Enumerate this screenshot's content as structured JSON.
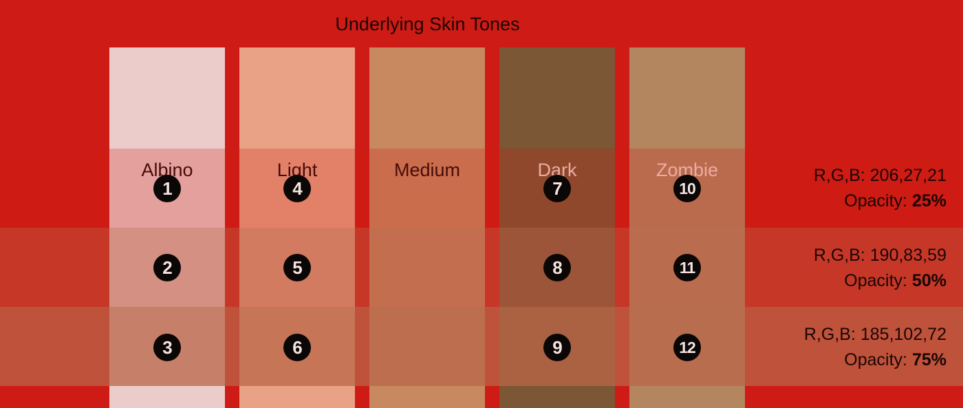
{
  "title": "Underlying Skin Tones",
  "tones": [
    {
      "label": "Albino",
      "color": "#ebccca",
      "label_color": "#1a0604"
    },
    {
      "label": "Light",
      "color": "#e9a285",
      "label_color": "#1a0604"
    },
    {
      "label": "Medium",
      "color": "#c88860",
      "label_color": "#1a0604"
    },
    {
      "label": "Dark",
      "color": "#7b5735",
      "label_color": "#f2ddd6"
    },
    {
      "label": "Zombie",
      "color": "#b48660",
      "label_color": "#f2ddd6"
    }
  ],
  "overlays": [
    {
      "rgb_label": "R,G,B: 206,27,21",
      "opacity_label": "Opacity: ",
      "opacity_value": "25%",
      "color": "#ce1b15",
      "opacity": 0.25
    },
    {
      "rgb_label": "R,G,B: 190,83,59",
      "opacity_label": "Opacity: ",
      "opacity_value": "50%",
      "color": "#be533b",
      "opacity": 0.5
    },
    {
      "rgb_label": "R,G,B: 185,102,72",
      "opacity_label": "Opacity: ",
      "opacity_value": "75%",
      "color": "#b96648",
      "opacity": 0.75
    }
  ],
  "markers": [
    "1",
    "2",
    "3",
    "4",
    "5",
    "6",
    "7",
    "8",
    "9",
    "10",
    "11",
    "12"
  ],
  "background_color": "#ce1b15"
}
